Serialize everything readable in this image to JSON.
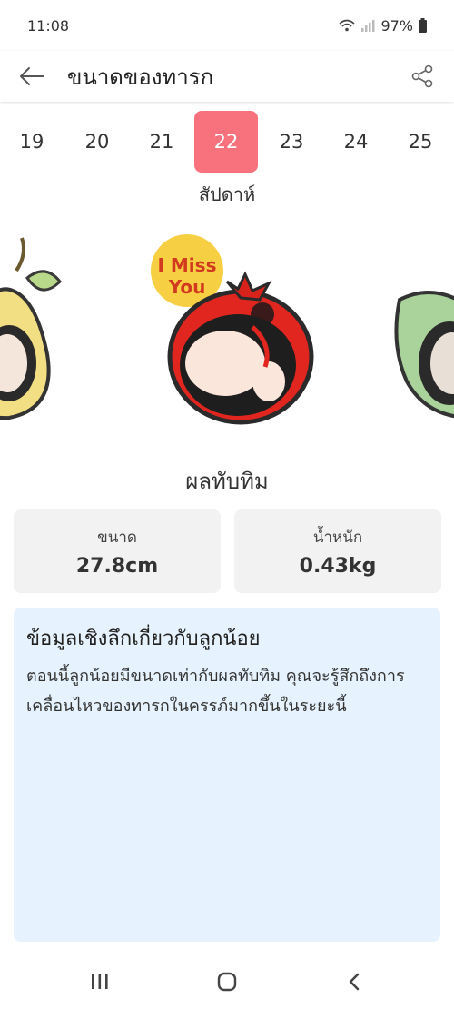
{
  "status_bar": {
    "time": "11:08",
    "battery": "97%"
  },
  "app_bar": {
    "title": "ขนาดของทารก"
  },
  "weeks": {
    "items": [
      "19",
      "20",
      "21",
      "22",
      "23",
      "24",
      "25"
    ],
    "active": "22",
    "label": "สัปดาห์"
  },
  "fruit": {
    "bubble_text_1": "I Miss",
    "bubble_text_2": "You",
    "name": "ผลทับทิม"
  },
  "stats": {
    "size_label": "ขนาด",
    "size_value": "27.8cm",
    "weight_label": "น้ำหนัก",
    "weight_value": "0.43kg"
  },
  "insight": {
    "title": "ข้อมูลเชิงลึกเกี่ยวกับลูกน้อย",
    "body": "ตอนนี้ลูกน้อยมีขนาดเท่ากับผลทับทิม คุณจะรู้สึกถึงการเคลื่อนไหวของทารกในครรภ์มากขึ้นในระยะนี้"
  },
  "colors": {
    "accent": "#f7727d",
    "insight_bg": "#e6f2fe",
    "card_bg": "#f2f2f2"
  },
  "icons": [
    "wifi-icon",
    "signal-icon",
    "battery-icon",
    "back-arrow-icon",
    "share-icon",
    "recents-icon",
    "home-icon",
    "nav-back-icon"
  ]
}
